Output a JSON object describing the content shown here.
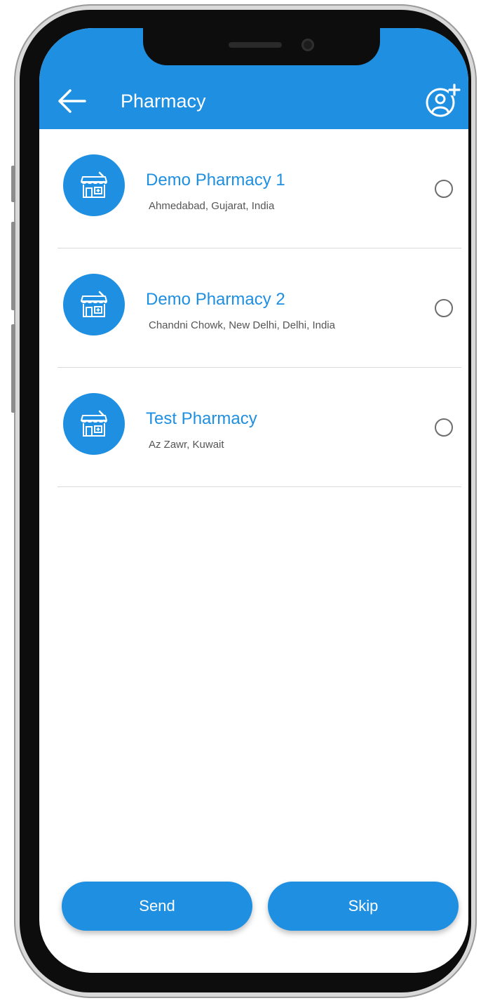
{
  "header": {
    "title": "Pharmacy",
    "back_icon": "arrow-left-icon",
    "add_icon": "add-user-icon"
  },
  "pharmacies": [
    {
      "name": "Demo Pharmacy 1",
      "address": "Ahmedabad, Gujarat, India",
      "selected": false
    },
    {
      "name": "Demo Pharmacy 2",
      "address": "Chandni Chowk, New Delhi, Delhi, India",
      "selected": false
    },
    {
      "name": "Test Pharmacy",
      "address": "Az Zawr, Kuwait",
      "selected": false
    }
  ],
  "actions": {
    "send_label": "Send",
    "skip_label": "Skip"
  },
  "colors": {
    "accent": "#1e8fe1",
    "title_text": "#ffffff",
    "address_text": "#555555",
    "divider": "#d9d9d9"
  }
}
